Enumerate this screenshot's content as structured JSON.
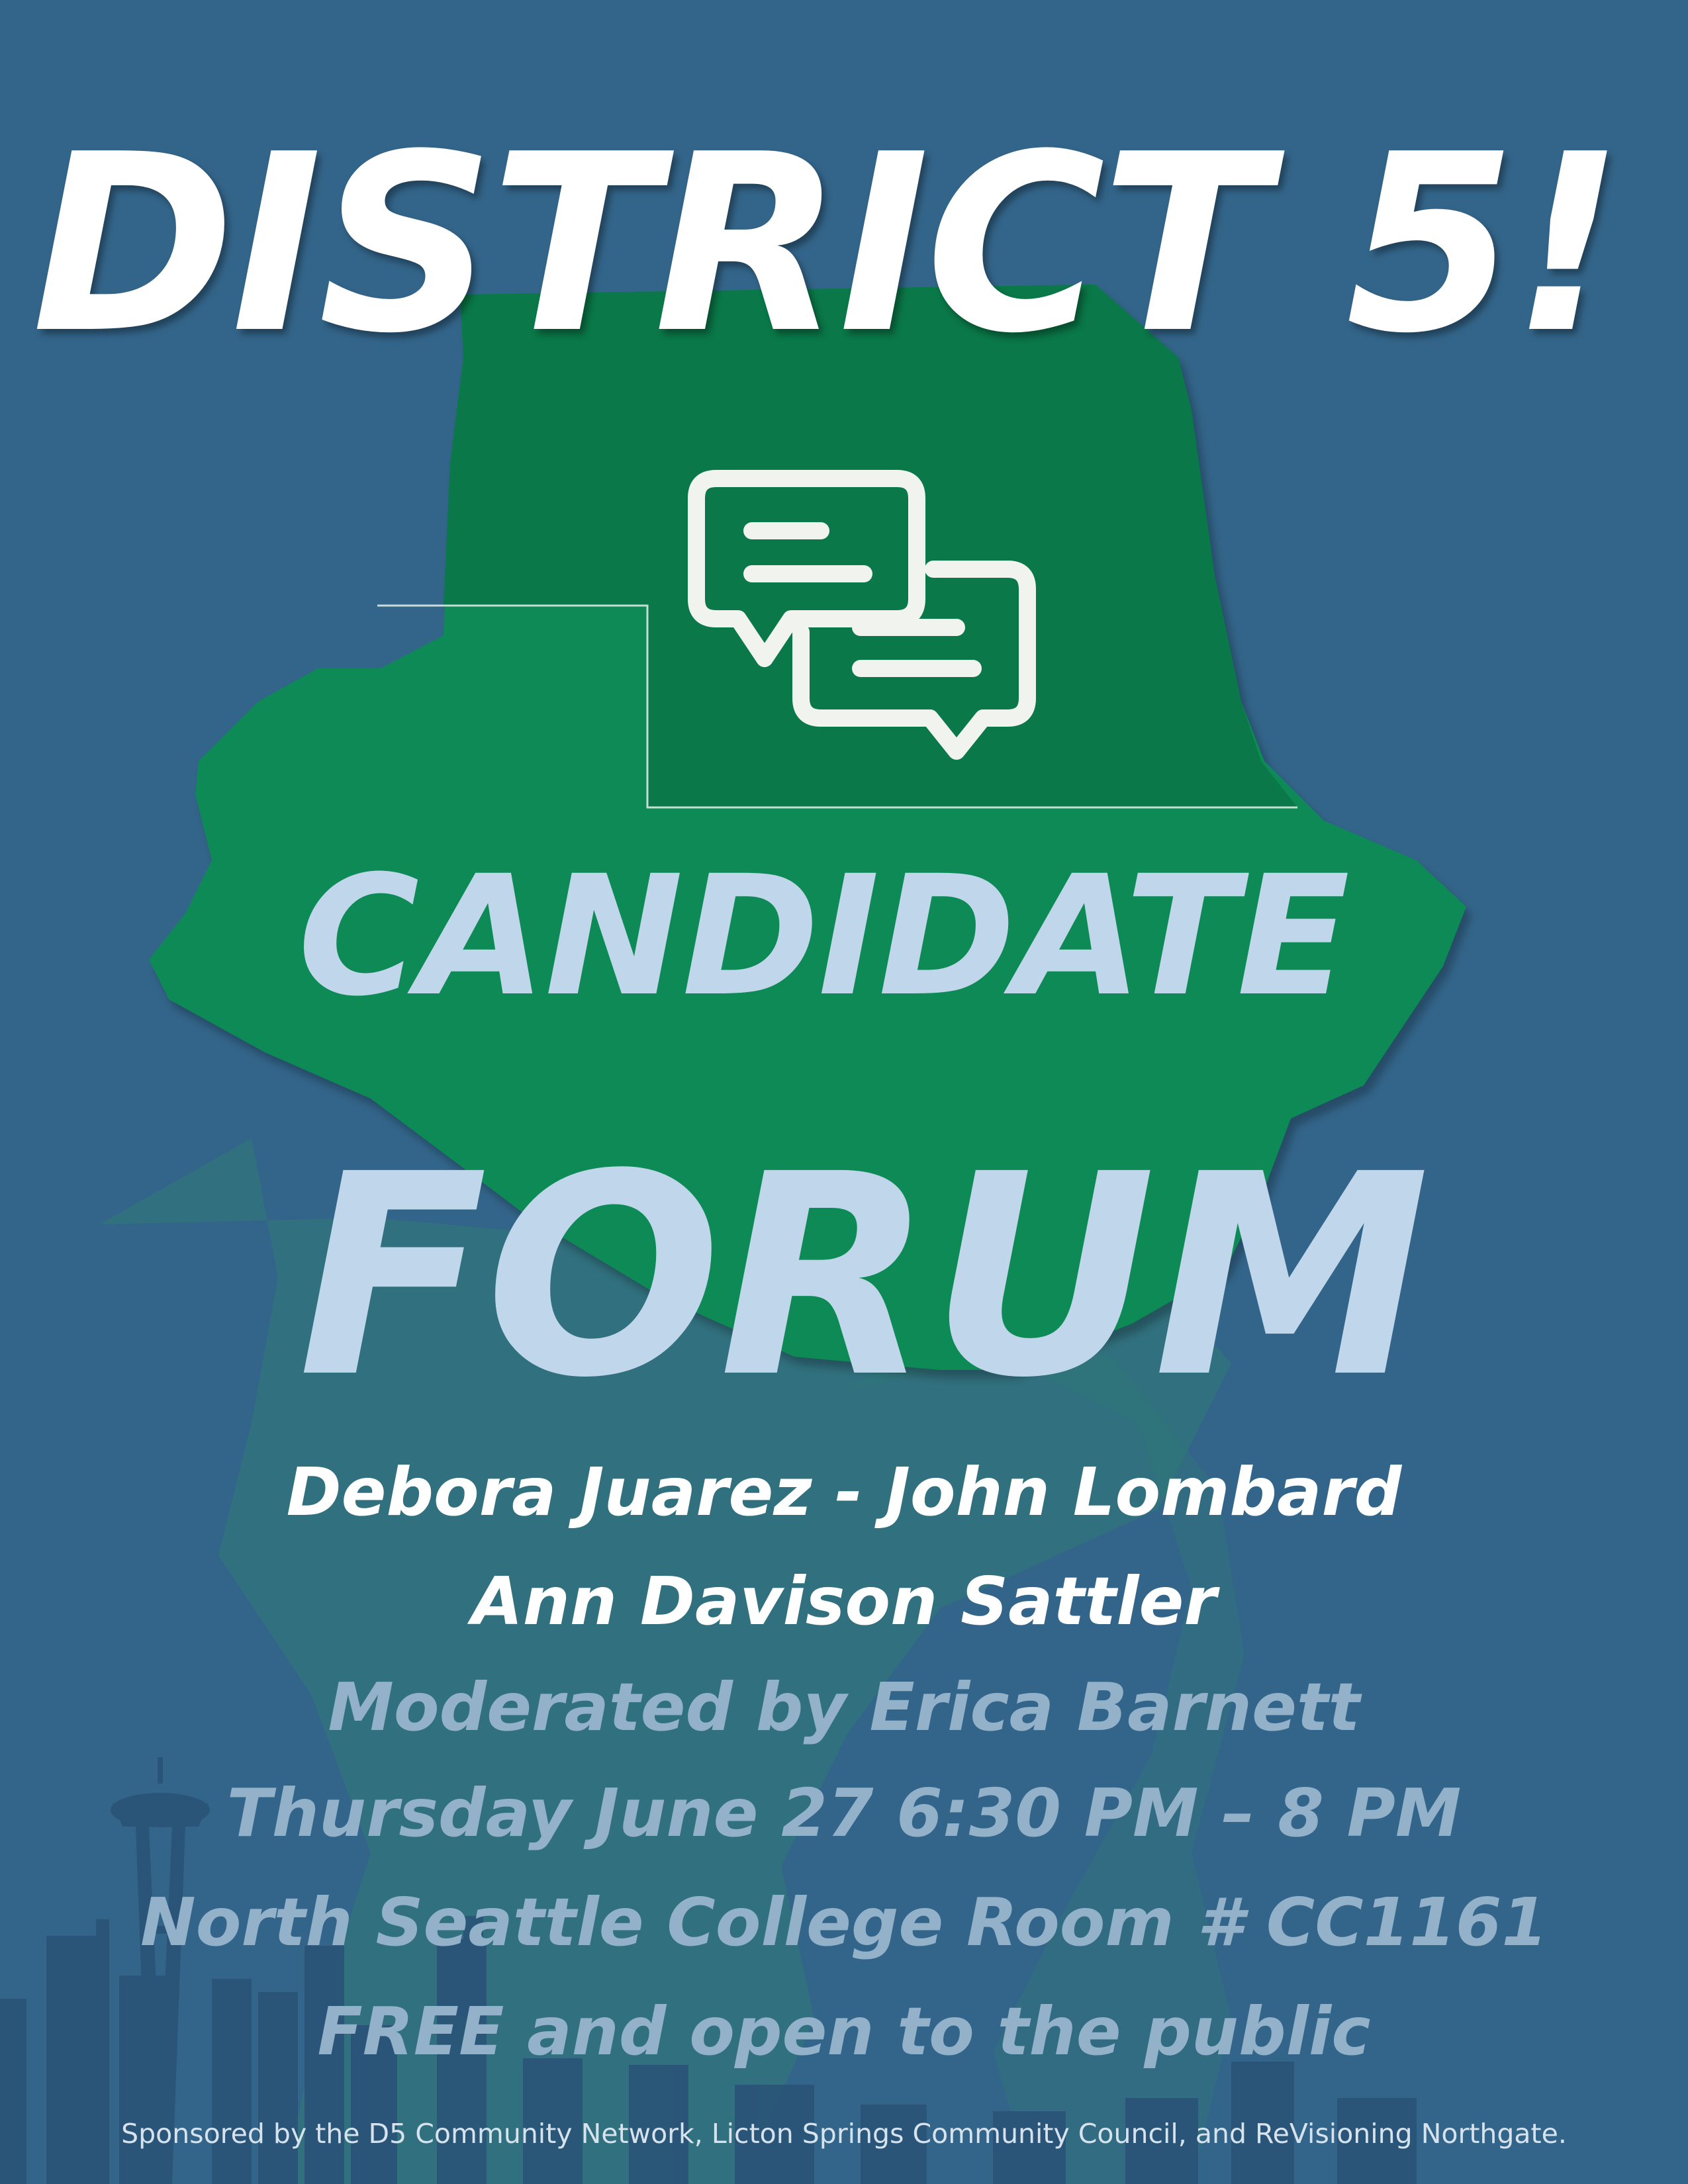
{
  "poster": {
    "title": "DISTRICT 5!",
    "subtitle_line1": "CANDIDATE",
    "subtitle_line2": "FORUM",
    "candidates_line1": "Debora Juarez - John Lombard",
    "candidates_line2": "Ann Davison Sattler",
    "moderator": "Moderated by Erica Barnett",
    "datetime": "Thursday June 27 6:30 PM – 8 PM",
    "location": "North Seattle College Room # CC1161",
    "admission": "FREE and open to the public",
    "sponsors": "Sponsored by the D5 Community Network, Licton Springs Community Council, and ReVisioning Northgate.",
    "icon": "chat-bubbles-icon",
    "colors": {
      "background": "#33658a",
      "district_green": "#0d8a55",
      "district_dark_green": "#0a7848",
      "light_blue_text": "#c0d6ea",
      "muted_text": "#93b2c9",
      "white": "#ffffff"
    }
  }
}
